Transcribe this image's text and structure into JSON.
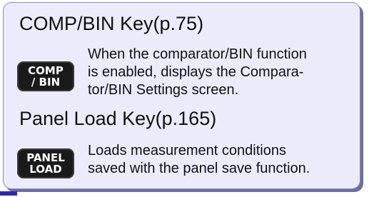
{
  "sections": [
    {
      "heading": "COMP/BIN Key(p.75)",
      "key": {
        "line1": "COMP",
        "line2": "/ BIN"
      },
      "description": [
        "When the comparator/BIN function",
        "is enabled, displays the Compara-",
        "tor/BIN Settings screen."
      ]
    },
    {
      "heading": "Panel Load Key(p.165)",
      "key": {
        "line1": "PANEL",
        "line2": "LOAD"
      },
      "description": [
        "Loads measurement conditions",
        "saved with the panel save function."
      ]
    }
  ],
  "colors": {
    "box_background": "#ebebfc",
    "box_border": "#8a8ac8",
    "accent": "#2b2ba8",
    "key_background": "#1a1a1a"
  }
}
